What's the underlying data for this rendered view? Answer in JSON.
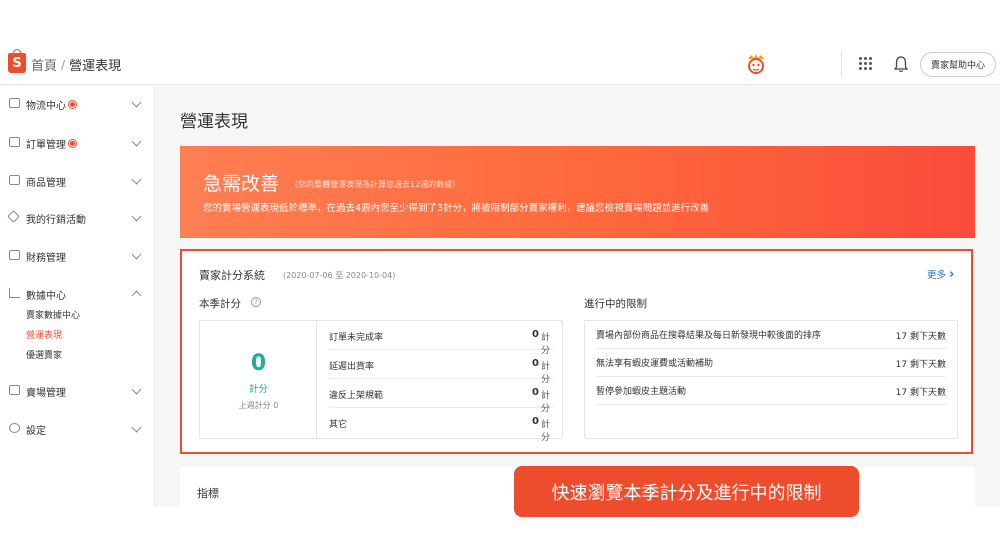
{
  "topbar": {
    "breadcrumb_home": "首頁",
    "breadcrumb_sep": "/",
    "breadcrumb_current": "營運表現",
    "help_button": "賣家幫助中心",
    "logo_letter": "S"
  },
  "sidebar": {
    "items": [
      {
        "label": "物流中心",
        "badge": true
      },
      {
        "label": "訂單管理",
        "badge": true
      },
      {
        "label": "商品管理"
      },
      {
        "label": "我的行銷活動"
      },
      {
        "label": "財務管理"
      },
      {
        "label": "數據中心",
        "expanded": true
      },
      {
        "label": "賣場管理"
      },
      {
        "label": "設定"
      }
    ],
    "sub_items": [
      "賣家數據中心",
      "營運表現",
      "優選賣家"
    ],
    "active_sub": "營運表現"
  },
  "main": {
    "page_title": "營運表現",
    "banner": {
      "title": "急需改善",
      "note": "（您的整體營運表現為計算您過去12週的數據）",
      "description": "您的賣場營運表現低於標準，在過去4週內您至少得到了3計分，將被限制部分賣家權利，建議您檢視賣場問題並進行改善"
    },
    "score_card": {
      "title": "賣家計分系統",
      "date_range": "(2020-07-06 至 2020-10-04)",
      "more": "更多",
      "season_label": "本季計分",
      "limits_label": "進行中的限制",
      "score_value": "0",
      "score_unit": "計分",
      "last_week": "上週計分 0",
      "rows": [
        {
          "name": "訂單未完成率",
          "value": "0",
          "unit": "計分"
        },
        {
          "name": "延遲出貨率",
          "value": "0",
          "unit": "計分"
        },
        {
          "name": "違反上架規範",
          "value": "0",
          "unit": "計分"
        },
        {
          "name": "其它",
          "value": "0",
          "unit": "計分"
        }
      ],
      "limits": [
        {
          "name": "賣場內部份商品在搜尋結果及每日新發現中較後面的排序",
          "days": "17 剩下天數"
        },
        {
          "name": "無法享有蝦皮運費或活動補助",
          "days": "17 剩下天數"
        },
        {
          "name": "暫停參加蝦皮主題活動",
          "days": "17 剩下天數"
        }
      ]
    },
    "indicators_title": "指標"
  },
  "callout": "快速瀏覽本季計分及進行中的限制",
  "colors": {
    "brand": "#ee4d2d",
    "score_green": "#26aa99",
    "link_blue": "#2673dd"
  }
}
